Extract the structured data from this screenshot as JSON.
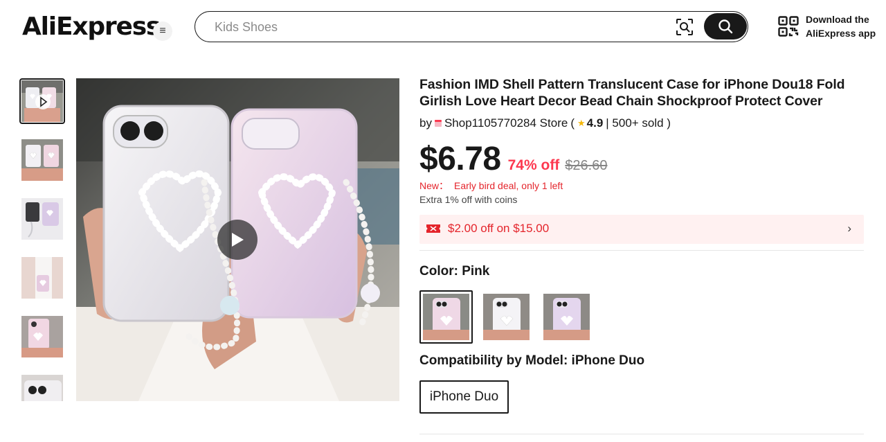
{
  "header": {
    "logo": "AliExpress",
    "menu_icon": "menu-icon",
    "search": {
      "placeholder": "Kids Shoes",
      "value": ""
    },
    "scan_icon": "image-search-icon",
    "search_icon": "search-icon",
    "download": {
      "line1": "Download the",
      "line2": "AliExpress app"
    }
  },
  "gallery": {
    "thumbnails": [
      "Video",
      "Photo 2",
      "Photo 3",
      "Photo 4",
      "Photo 5",
      "Photo 6"
    ],
    "active_index": 0,
    "play_icon": "play-icon"
  },
  "product": {
    "title": "Fashion IMD Shell Pattern Translucent Case for iPhone Dou18 Fold Girlish Love Heart Decor Bead Chain Shockproof Protect Cover",
    "by": "by",
    "store": "Shop1105770284 Store",
    "open_paren": "(",
    "rating": "4.9",
    "sold": "| 500+ sold )",
    "price": "$6.78",
    "discount": "74% off",
    "original_price": "$26.60",
    "deal_prefix": "New：",
    "deal_text": "Early bird deal, only 1 left",
    "coins_text": "Extra 1% off with coins",
    "coupon_text": "$2.00 off on $15.00",
    "coupon_arrow": "›",
    "color_label": "Color: Pink",
    "colors": [
      "Pink",
      "White",
      "Purple"
    ],
    "selected_color_index": 0,
    "compat_label": "Compatibility by Model: iPhone Duo",
    "model_option": "iPhone Duo"
  },
  "colors": {
    "accent_red": "#fd384f",
    "deal_red": "#e4242b",
    "coupon_bg": "#fff1f1",
    "dark": "#191919",
    "rating_star": "#f5b80a"
  }
}
